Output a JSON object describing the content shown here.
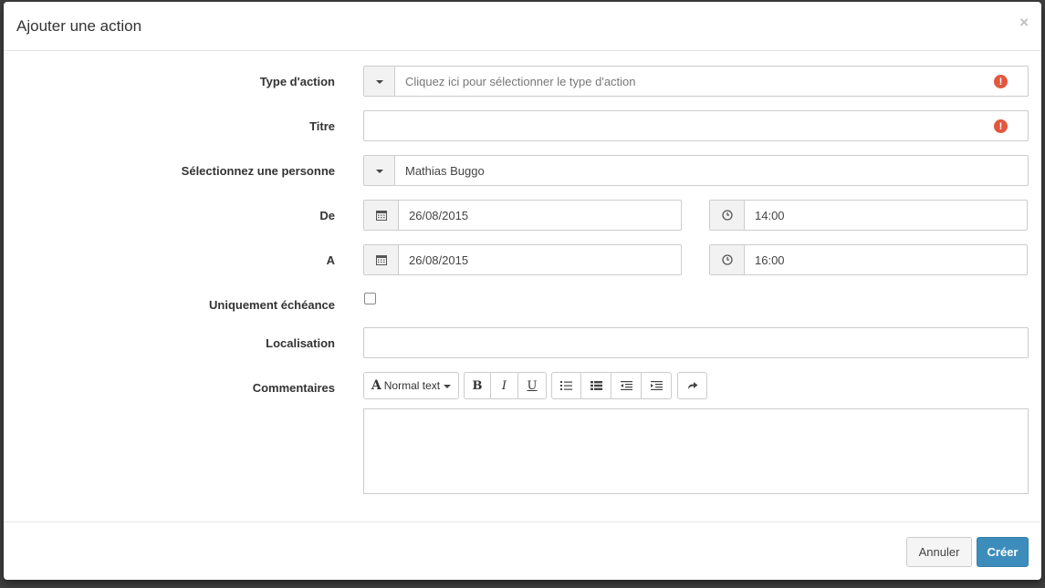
{
  "modal": {
    "title": "Ajouter une action",
    "close_label": "×"
  },
  "form": {
    "type_action": {
      "label": "Type d'action",
      "placeholder": "Cliquez ici pour sélectionner le type d'action",
      "error_mark": "!"
    },
    "titre": {
      "label": "Titre",
      "value": "",
      "error_mark": "!"
    },
    "personne": {
      "label": "Sélectionnez une personne",
      "value": "Mathias Buggo"
    },
    "de": {
      "label": "De",
      "date": "26/08/2015",
      "time": "14:00"
    },
    "a": {
      "label": "A",
      "date": "26/08/2015",
      "time": "16:00"
    },
    "uniquement_echeance": {
      "label": "Uniquement échéance",
      "checked": false
    },
    "localisation": {
      "label": "Localisation",
      "value": ""
    },
    "commentaires": {
      "label": "Commentaires",
      "value": "",
      "toolbar": {
        "font_style_label": "Normal text",
        "bold": "B",
        "italic": "I",
        "underline": "U"
      }
    }
  },
  "footer": {
    "cancel_label": "Annuler",
    "create_label": "Créer"
  },
  "colors": {
    "primary": "#3c8dbc",
    "error": "#e2573e"
  }
}
